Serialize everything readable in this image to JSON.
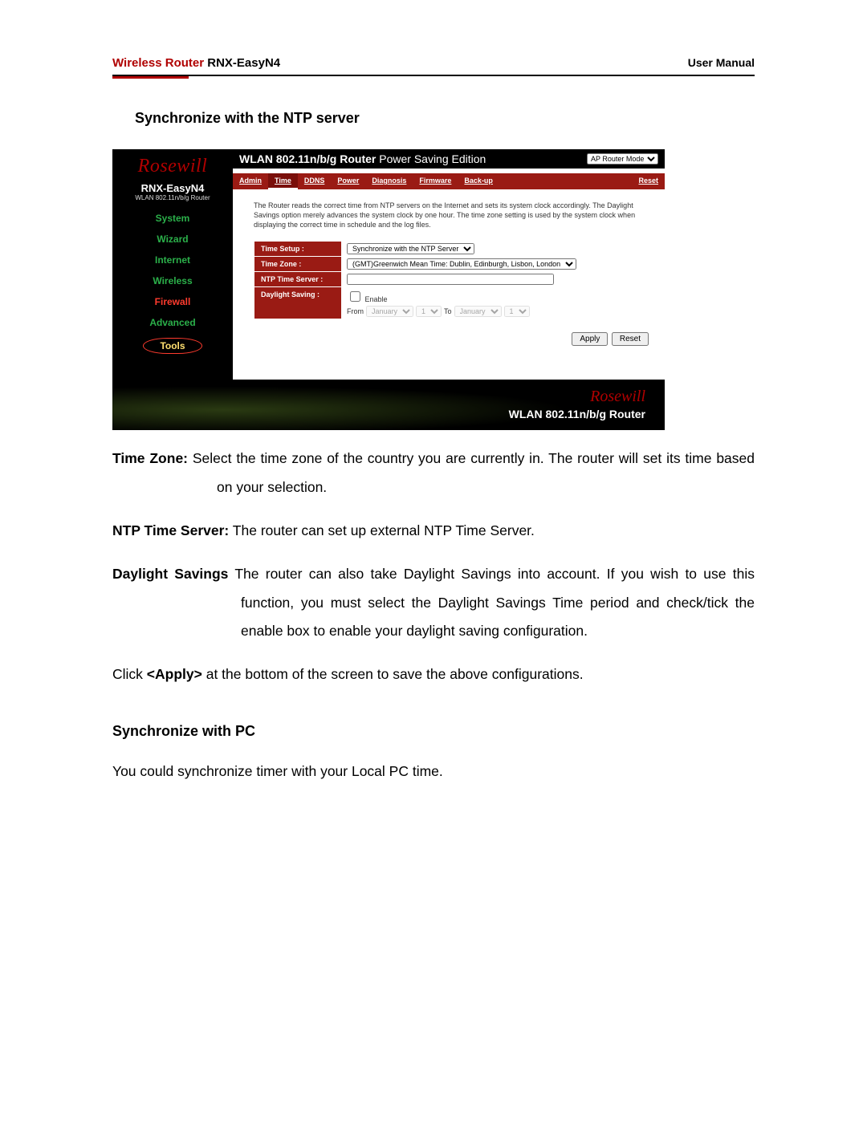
{
  "header": {
    "wireless_router": "Wireless Router",
    "model": "RNX-EasyN4",
    "user_manual": "User Manual"
  },
  "section1_heading": "Synchronize with the NTP server",
  "router": {
    "logo_brand": "Rosewill",
    "sidebar_model": "RNX-EasyN4",
    "sidebar_wlan": "WLAN 802.11n/b/g Router",
    "nav": {
      "system": "System",
      "wizard": "Wizard",
      "internet": "Internet",
      "wireless": "Wireless",
      "firewall": "Firewall",
      "advanced": "Advanced",
      "tools": "Tools"
    },
    "title_bold": "WLAN 802.11n/b/g Router",
    "title_rest": " Power Saving Edition",
    "mode_select": "AP Router Mode",
    "tabs": {
      "admin": "Admin",
      "time": "Time",
      "ddns": "DDNS",
      "power": "Power",
      "diagnosis": "Diagnosis",
      "firmware": "Firmware",
      "backup": "Back-up",
      "reset": "Reset"
    },
    "description": "The Router reads the correct time from NTP servers on the Internet and sets its system clock accordingly. The Daylight Savings option merely advances the system clock by one hour. The time zone setting is used by the system clock when displaying the correct time in schedule and the log files.",
    "labels": {
      "time_setup": "Time Setup :",
      "time_zone": "Time Zone :",
      "ntp": "NTP Time Server :",
      "daylight": "Daylight Saving :"
    },
    "values": {
      "time_setup_sel": "Synchronize with the NTP Server",
      "time_zone_sel": "(GMT)Greenwich Mean Time: Dublin, Edinburgh, Lisbon, London",
      "ntp_value": "",
      "enable_label": "Enable",
      "from_label": "From",
      "to_label": "To",
      "month_from": "January",
      "day_from": "1",
      "month_to": "January",
      "day_to": "1"
    },
    "buttons": {
      "apply": "Apply",
      "reset": "Reset"
    },
    "footer_text": "WLAN 802.11n/b/g Router"
  },
  "manual": {
    "tz_bold": "Time Zone:",
    "tz_text": " Select the time zone of the country you are currently in. The router will set its time based on your selection.",
    "ntp_bold": "NTP Time Server:",
    "ntp_text": " The router can set up external NTP Time Server.",
    "ds_bold": "Daylight Savings",
    "ds_text": " The router can also take Daylight Savings into account. If you wish to use this function, you must select the Daylight Savings Time period and check/tick the enable box to enable your daylight saving configuration.",
    "apply_pre": "Click ",
    "apply_bold": "<Apply>",
    "apply_post": " at the bottom of the screen to save the above configurations.",
    "sync_pc_heading": "Synchronize with PC",
    "sync_pc_body": "You could synchronize timer with your Local PC time."
  }
}
